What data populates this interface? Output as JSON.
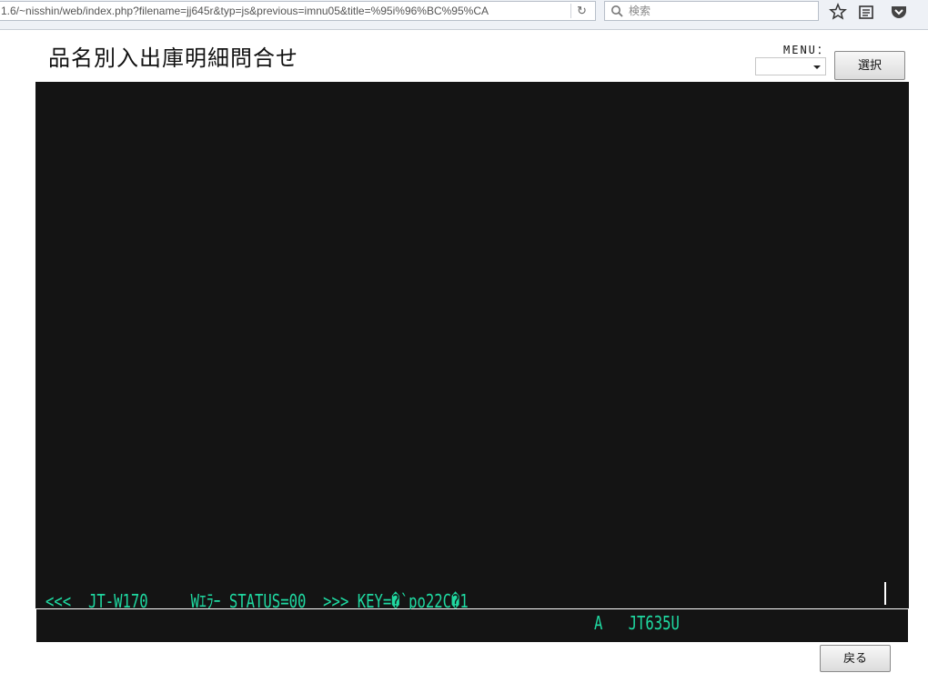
{
  "browser": {
    "url": "1.6/~nisshin/web/index.php?filename=jj645r&typ=js&previous=imnu05&title=%95i%96%BC%95%CA",
    "search_placeholder": "検索",
    "icons": [
      "reload-icon",
      "search-icon",
      "bookmark-star-icon",
      "reading-list-icon",
      "pocket-icon"
    ]
  },
  "page": {
    "title": "品名別入出庫明細問合せ",
    "menu_label": "MENU：",
    "menu_selected": "",
    "select_button": "選択",
    "back_button": "戻る"
  },
  "terminal": {
    "message_line": "<<<  JT-W170     Wｴﾗｰ STATUS=00  >>> KEY=�`po22C�1",
    "status_line": "A   JT635U",
    "text_color": "#1fd9a1",
    "background_color": "#141414"
  }
}
